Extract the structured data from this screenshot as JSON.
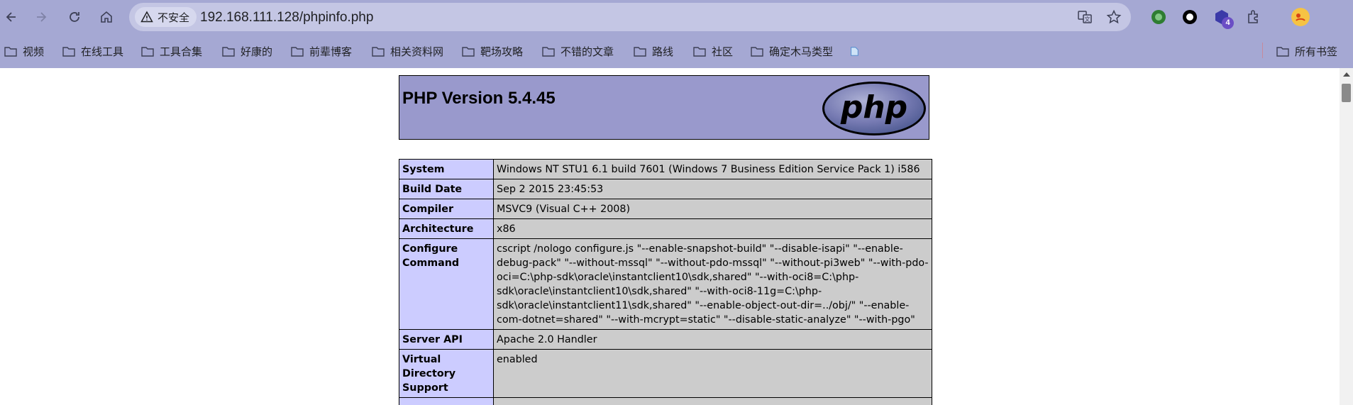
{
  "browser": {
    "security_label": "不安全",
    "url": "192.168.111.128/phpinfo.php",
    "extension_badge": "4",
    "bookmarks": [
      {
        "label": "视频"
      },
      {
        "label": "在线工具"
      },
      {
        "label": "工具合集"
      },
      {
        "label": "好康的"
      },
      {
        "label": "前辈博客"
      },
      {
        "label": "相关资料网"
      },
      {
        "label": "靶场攻略"
      },
      {
        "label": "不错的文章"
      },
      {
        "label": "路线"
      },
      {
        "label": "社区"
      },
      {
        "label": "确定木马类型"
      }
    ],
    "all_bookmarks_label": "所有书签"
  },
  "page": {
    "title": "PHP Version 5.4.45",
    "logo_text": "php",
    "rows": [
      {
        "key": "System",
        "value": "Windows NT STU1 6.1 build 7601 (Windows 7 Business Edition Service Pack 1) i586"
      },
      {
        "key": "Build Date",
        "value": "Sep 2 2015 23:45:53"
      },
      {
        "key": "Compiler",
        "value": "MSVC9 (Visual C++ 2008)"
      },
      {
        "key": "Architecture",
        "value": "x86"
      },
      {
        "key": "Configure Command",
        "value": "cscript /nologo configure.js \"--enable-snapshot-build\" \"--disable-isapi\" \"--enable-debug-pack\" \"--without-mssql\" \"--without-pdo-mssql\" \"--without-pi3web\" \"--with-pdo-oci=C:\\php-sdk\\oracle\\instantclient10\\sdk,shared\" \"--with-oci8=C:\\php-sdk\\oracle\\instantclient10\\sdk,shared\" \"--with-oci8-11g=C:\\php-sdk\\oracle\\instantclient11\\sdk,shared\" \"--enable-object-out-dir=../obj/\" \"--enable-com-dotnet=shared\" \"--with-mcrypt=static\" \"--disable-static-analyze\" \"--with-pgo\""
      },
      {
        "key": "Server API",
        "value": "Apache 2.0 Handler"
      },
      {
        "key": "Virtual Directory Support",
        "value": "enabled"
      }
    ]
  }
}
